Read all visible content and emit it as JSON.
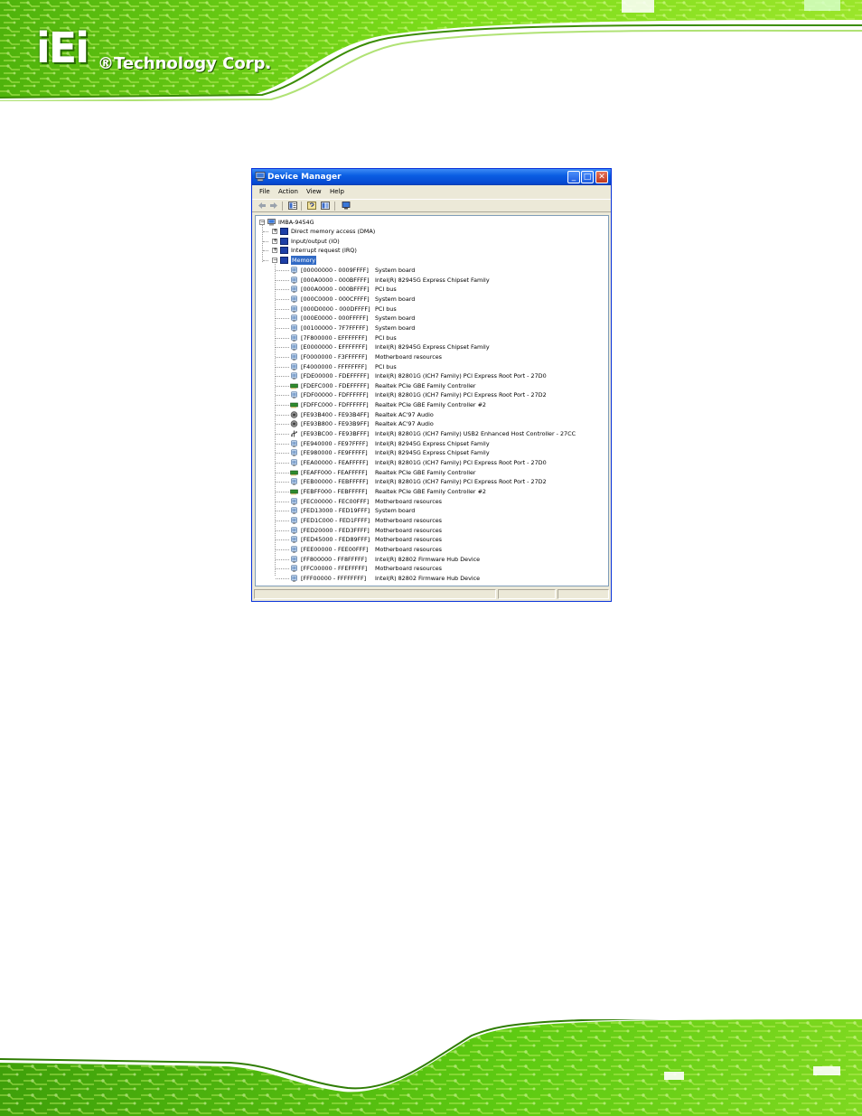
{
  "brand": {
    "logo_text": "iEi",
    "corp_text": "®Technology Corp."
  },
  "window": {
    "title": "Device Manager",
    "controls": {
      "minimize": "_",
      "maximize": "□",
      "close": "✕"
    }
  },
  "menu": [
    "File",
    "Action",
    "View",
    "Help"
  ],
  "toolbar_icons": [
    "back-arrow-icon",
    "forward-arrow-icon",
    "properties-icon",
    "help-icon",
    "scan-hardware-icon",
    "monitor-icon"
  ],
  "tree": {
    "root": "IMBA-9454G",
    "categories": [
      {
        "label": "Direct memory access (DMA)",
        "expanded": false
      },
      {
        "label": "Input/output (IO)",
        "expanded": false
      },
      {
        "label": "Interrupt request (IRQ)",
        "expanded": false
      },
      {
        "label": "Memory",
        "expanded": true,
        "selected": true
      }
    ],
    "memory_items": [
      {
        "range": "[00000000 - 0009FFFF]",
        "device": "System board",
        "icon": "chip-icon"
      },
      {
        "range": "[000A0000 - 000BFFFF]",
        "device": "Intel(R) 82945G Express Chipset Family",
        "icon": "chip-icon"
      },
      {
        "range": "[000A0000 - 000BFFFF]",
        "device": "PCI bus",
        "icon": "chip-icon"
      },
      {
        "range": "[000C0000 - 000CFFFF]",
        "device": "System board",
        "icon": "chip-icon"
      },
      {
        "range": "[000D0000 - 000DFFFF]",
        "device": "PCI bus",
        "icon": "chip-icon"
      },
      {
        "range": "[000E0000 - 000FFFFF]",
        "device": "System board",
        "icon": "chip-icon"
      },
      {
        "range": "[00100000 - 7F7FFFFF]",
        "device": "System board",
        "icon": "chip-icon"
      },
      {
        "range": "[7F800000 - EFFFFFFF]",
        "device": "PCI bus",
        "icon": "chip-icon"
      },
      {
        "range": "[E0000000 - EFFFFFFF]",
        "device": "Intel(R) 82945G Express Chipset Family",
        "icon": "chip-icon"
      },
      {
        "range": "[F0000000 - F3FFFFFF]",
        "device": "Motherboard resources",
        "icon": "chip-icon"
      },
      {
        "range": "[F4000000 - FFFFFFFF]",
        "device": "PCI bus",
        "icon": "chip-icon"
      },
      {
        "range": "[FDE00000 - FDEFFFFF]",
        "device": "Intel(R) 82801G (ICH7 Family) PCI Express Root Port - 27D0",
        "icon": "chip-icon"
      },
      {
        "range": "[FDEFC000 - FDEFFFFF]",
        "device": "Realtek PCIe GBE Family Controller",
        "icon": "network-card-icon"
      },
      {
        "range": "[FDF00000 - FDFFFFFF]",
        "device": "Intel(R) 82801G (ICH7 Family) PCI Express Root Port - 27D2",
        "icon": "chip-icon"
      },
      {
        "range": "[FDFFC000 - FDFFFFFF]",
        "device": "Realtek PCIe GBE Family Controller #2",
        "icon": "network-card-icon"
      },
      {
        "range": "[FE93B400 - FE93B4FF]",
        "device": "Realtek AC'97 Audio",
        "icon": "speaker-icon"
      },
      {
        "range": "[FE93B800 - FE93B9FF]",
        "device": "Realtek AC'97 Audio",
        "icon": "speaker-icon"
      },
      {
        "range": "[FE93BC00 - FE93BFFF]",
        "device": "Intel(R) 82801G (ICH7 Family) USB2 Enhanced Host Controller - 27CC",
        "icon": "usb-icon"
      },
      {
        "range": "[FE940000 - FE97FFFF]",
        "device": "Intel(R) 82945G Express Chipset Family",
        "icon": "chip-icon"
      },
      {
        "range": "[FE980000 - FE9FFFFF]",
        "device": "Intel(R) 82945G Express Chipset Family",
        "icon": "chip-icon"
      },
      {
        "range": "[FEA00000 - FEAFFFFF]",
        "device": "Intel(R) 82801G (ICH7 Family) PCI Express Root Port - 27D0",
        "icon": "chip-icon"
      },
      {
        "range": "[FEAFF000 - FEAFFFFF]",
        "device": "Realtek PCIe GBE Family Controller",
        "icon": "network-card-icon"
      },
      {
        "range": "[FEB00000 - FEBFFFFF]",
        "device": "Intel(R) 82801G (ICH7 Family) PCI Express Root Port - 27D2",
        "icon": "chip-icon"
      },
      {
        "range": "[FEBFF000 - FEBFFFFF]",
        "device": "Realtek PCIe GBE Family Controller #2",
        "icon": "network-card-icon"
      },
      {
        "range": "[FEC00000 - FEC00FFF]",
        "device": "Motherboard resources",
        "icon": "chip-icon"
      },
      {
        "range": "[FED13000 - FED19FFF]",
        "device": "System board",
        "icon": "chip-icon"
      },
      {
        "range": "[FED1C000 - FED1FFFF]",
        "device": "Motherboard resources",
        "icon": "chip-icon"
      },
      {
        "range": "[FED20000 - FED3FFFF]",
        "device": "Motherboard resources",
        "icon": "chip-icon"
      },
      {
        "range": "[FED45000 - FED89FFF]",
        "device": "Motherboard resources",
        "icon": "chip-icon"
      },
      {
        "range": "[FEE00000 - FEE00FFF]",
        "device": "Motherboard resources",
        "icon": "chip-icon"
      },
      {
        "range": "[FF800000 - FF8FFFFF]",
        "device": "Intel(R) 82802 Firmware Hub Device",
        "icon": "chip-icon"
      },
      {
        "range": "[FFC00000 - FFEFFFFF]",
        "device": "Motherboard resources",
        "icon": "chip-icon"
      },
      {
        "range": "[FFF00000 - FFFFFFFF]",
        "device": "Intel(R) 82802 Firmware Hub Device",
        "icon": "chip-icon"
      }
    ]
  },
  "colors": {
    "selection": "#316ac5",
    "title_bar": "#0a5ee3",
    "window_face": "#ece9d8",
    "pcb_green": "#5ecb12"
  }
}
